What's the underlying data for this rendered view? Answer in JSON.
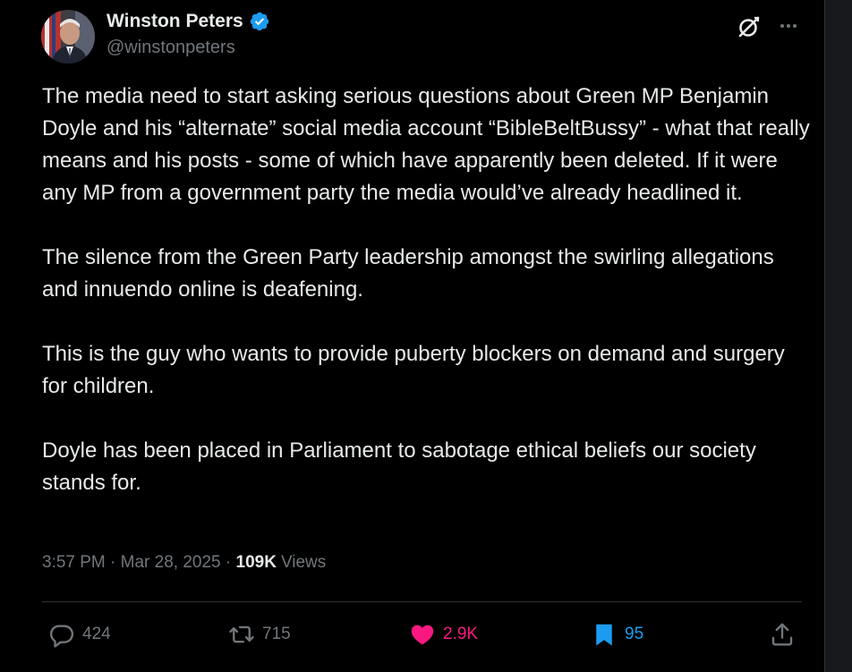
{
  "author": {
    "name": "Winston Peters",
    "handle": "@winstonpeters",
    "verified": true
  },
  "tweet": {
    "paragraphs": [
      "The media need to start asking serious questions about Green MP Benjamin Doyle and his “alternate” social media account “BibleBeltBussy” - what that really means and his posts - some of which have apparently been deleted. If it were any MP from a government party the media would’ve already headlined it.",
      "The silence from the Green Party leadership amongst the swirling allegations and innuendo online is deafening.",
      "This is the guy who wants to provide puberty blockers on demand and surgery for children.",
      "Doyle has been placed in Parliament to sabotage ethical beliefs our society stands for."
    ],
    "time": "3:57 PM",
    "separator": " · ",
    "date": "Mar 28, 2025",
    "views_count": "109K",
    "views_label": "Views"
  },
  "actions": {
    "replies": "424",
    "reposts": "715",
    "likes": "2.9K",
    "bookmarks": "95"
  },
  "icons": {
    "verified": "verified-badge-icon",
    "grok": "grok-icon",
    "more": "more-icon",
    "reply": "reply-icon",
    "repost": "repost-icon",
    "like": "heart-icon",
    "bookmark": "bookmark-icon",
    "share": "share-icon"
  },
  "colors": {
    "background": "#000000",
    "text": "#e7e9ea",
    "muted": "#71767b",
    "verified": "#1d9bf0",
    "like": "#f91880",
    "bookmark": "#1d9bf0"
  }
}
